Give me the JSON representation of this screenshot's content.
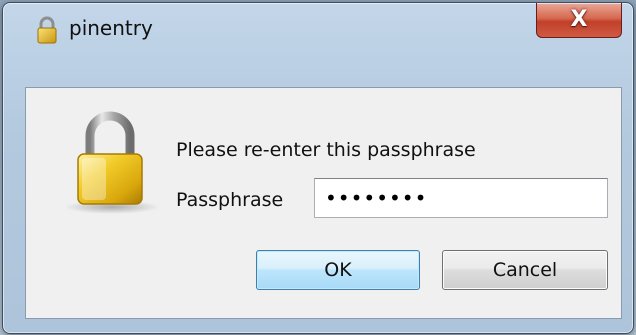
{
  "window": {
    "title": "pinentry",
    "close_glyph": "X"
  },
  "dialog": {
    "prompt": "Please re-enter this passphrase",
    "passphrase_label": "Passphrase",
    "passphrase_value": "••••••••"
  },
  "buttons": {
    "ok_label": "OK",
    "cancel_label": "Cancel"
  },
  "icons": {
    "title_icon": "padlock-icon",
    "dialog_icon": "padlock-icon",
    "close_icon": "close-icon"
  },
  "colors": {
    "lock_gold": "#e2b616",
    "ok_border": "#3c7fb1",
    "close_red": "#c2402a"
  }
}
